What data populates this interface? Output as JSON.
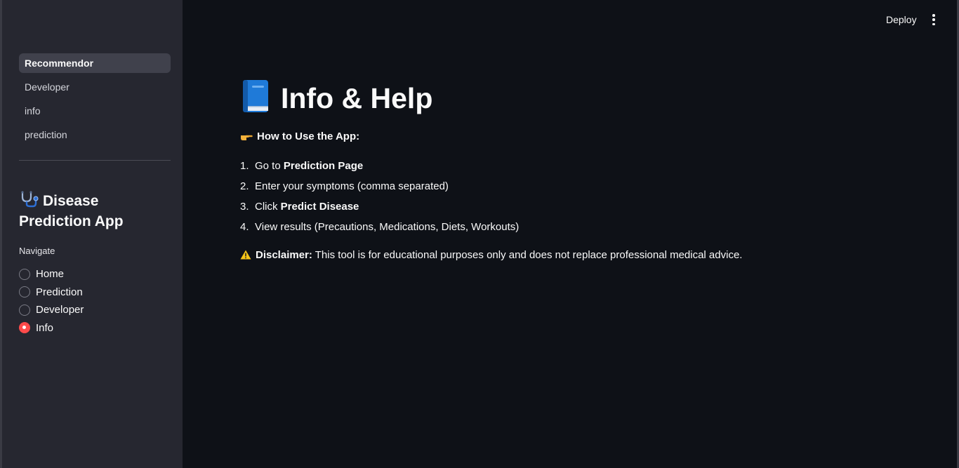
{
  "sidebar": {
    "nav": [
      {
        "label": "Recommendor",
        "active": true
      },
      {
        "label": "Developer",
        "active": false
      },
      {
        "label": "info",
        "active": false
      },
      {
        "label": "prediction",
        "active": false
      }
    ],
    "app_title": "Disease Prediction App",
    "app_icon": "stethoscope-icon",
    "radio_label": "Navigate",
    "radio_options": [
      {
        "label": "Home",
        "checked": false
      },
      {
        "label": "Prediction",
        "checked": false
      },
      {
        "label": "Developer",
        "checked": false
      },
      {
        "label": "Info",
        "checked": true
      }
    ]
  },
  "header": {
    "deploy_label": "Deploy",
    "menu_icon": "kebab-menu-icon"
  },
  "main": {
    "title": "Info & Help",
    "title_icon": "blue-book-icon",
    "howto_heading": "How to Use the App:",
    "howto_icon": "pointing-hand-icon",
    "steps": [
      {
        "num": "1.",
        "prefix": "Go to ",
        "bold": "Prediction Page",
        "suffix": ""
      },
      {
        "num": "2.",
        "prefix": "Enter your symptoms (comma separated)",
        "bold": "",
        "suffix": ""
      },
      {
        "num": "3.",
        "prefix": "Click ",
        "bold": "Predict Disease",
        "suffix": ""
      },
      {
        "num": "4.",
        "prefix": "View results (Precautions, Medications, Diets, Workouts)",
        "bold": "",
        "suffix": ""
      }
    ],
    "disclaimer_icon": "warning-icon",
    "disclaimer_label": "Disclaimer:",
    "disclaimer_text": " This tool is for educational purposes only and does not replace professional medical advice."
  },
  "colors": {
    "background": "#0e1117",
    "sidebar": "#262730",
    "accent": "#ff4b4b",
    "text": "#fafafa"
  }
}
